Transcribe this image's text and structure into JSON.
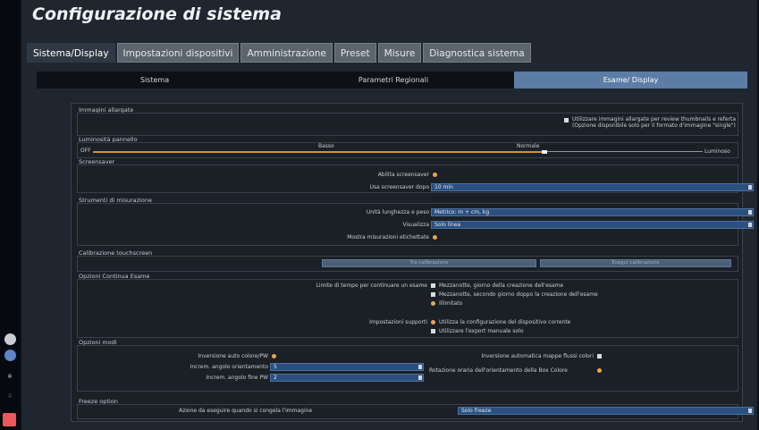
{
  "title": "Configurazione di sistema",
  "tabs": [
    "Sistema/Display",
    "Impostazioni dispositivi",
    "Amministrazione",
    "Preset",
    "Misure",
    "Diagnostica sistema"
  ],
  "subtabs": [
    "Sistema",
    "Parametri Regionali",
    "Esame/ Display"
  ],
  "sections": {
    "immagini": {
      "title": "Immagini allargate",
      "option_line1": "Utilizzare immagini allargate per review thumbnails e referta",
      "option_line2": "(Opzione disponibile solo per il formato d'immagine \"single\")"
    },
    "luminosita": {
      "title": "Luminosità pannello",
      "off": "OFF",
      "basso": "Basso",
      "normale": "Normale",
      "luminoso": "Luminoso",
      "level": 0.74
    },
    "screensaver": {
      "title": "Screensaver",
      "abilita": "Abilita screensaver",
      "usa_dopo": "Usa screensaver dopo",
      "usa_dopo_value": "10 min"
    },
    "strumenti": {
      "title": "Strumenti di misurazione",
      "unita": "Unità lunghezza e peso",
      "unita_value": "Metrico: m + cm, kg",
      "visualizza": "Visualizza",
      "visualizza_value": "Solo linea",
      "mostra": "Mostra misurazioni etichettate"
    },
    "calibrazione": {
      "title": "Calibrazione touchscreen",
      "btn1": "Tra calibrazione",
      "btn2": "Esegui calibrazione"
    },
    "opzioni_continua": {
      "title": "Opzioni Continua Esame",
      "limite": "Limite di tempo per continuare un esame",
      "opt1": "Mezzanotte, giorno della creazione dell'esame",
      "opt2": "Mezzanotte, secondo giorno doppo la creazione dell'esame",
      "opt3": "Illimitato",
      "impostazioni": "Impostazioni supporti",
      "sopt1": "Utilizza la configurazione del dispositivo corrente",
      "sopt2": "Utilizzare l'export manuale solo"
    },
    "opzioni_modi": {
      "title": "Opzioni modi",
      "inversione_colore": "Inversione auto colore/PW",
      "incrementi_orient": "Increm. angolo orientamento",
      "incrementi_orient_value": "5",
      "incrementi_pw": "Increm. angolo fine PW",
      "incrementi_pw_value": "2",
      "inversione_mappe": "Inversione automatica mappe flussi colori",
      "rotazione": "Rotazione oraria dell'orientamento della Box Colore"
    },
    "freeze": {
      "title": "Freeze option",
      "azione": "Azione da eseguire quando si congela l'immagine",
      "azione_value": "Solo freeze"
    }
  }
}
